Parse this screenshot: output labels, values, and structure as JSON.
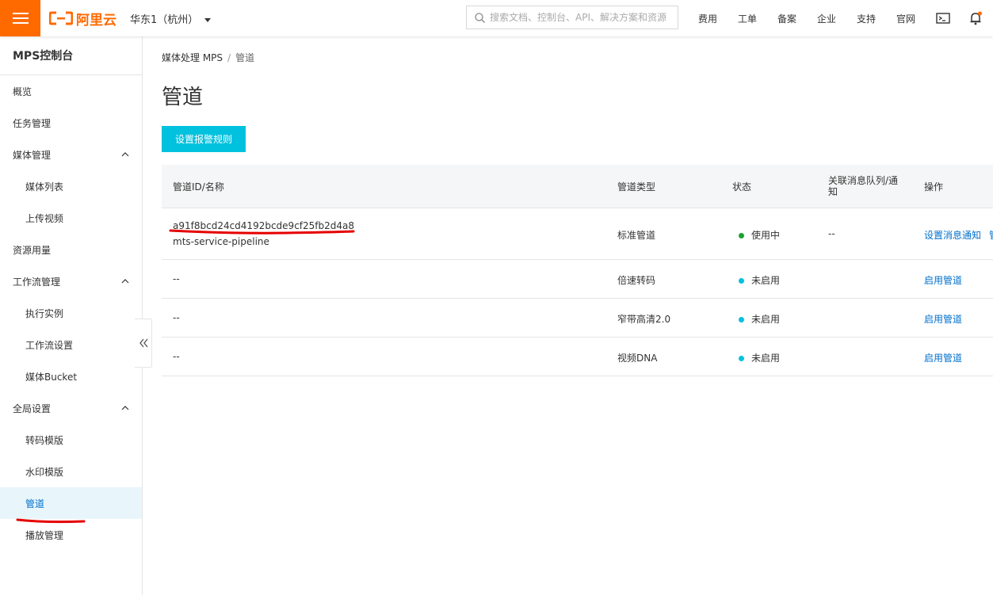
{
  "header": {
    "logo_text": "阿里云",
    "region": "华东1（杭州）",
    "search_placeholder": "搜索文档、控制台、API、解决方案和资源",
    "nav": [
      "费用",
      "工单",
      "备案",
      "企业",
      "支持",
      "官网"
    ]
  },
  "sidebar": {
    "title": "MPS控制台",
    "items": [
      {
        "label": "概览"
      },
      {
        "label": "任务管理"
      },
      {
        "label": "媒体管理"
      },
      {
        "label": "媒体列表"
      },
      {
        "label": "上传视频"
      },
      {
        "label": "资源用量"
      },
      {
        "label": "工作流管理"
      },
      {
        "label": "执行实例"
      },
      {
        "label": "工作流设置"
      },
      {
        "label": "媒体Bucket"
      },
      {
        "label": "全局设置"
      },
      {
        "label": "转码模版"
      },
      {
        "label": "水印模版"
      },
      {
        "label": "管道"
      },
      {
        "label": "播放管理"
      }
    ]
  },
  "breadcrumb": {
    "parent": "媒体处理 MPS",
    "separator": "/",
    "current": "管道"
  },
  "page": {
    "title": "管道",
    "alarm_button": "设置报警规则"
  },
  "table": {
    "headers": {
      "id_name": "管道ID/名称",
      "type": "管道类型",
      "status": "状态",
      "queue_line1": "关联消息队列/通",
      "queue_line2": "知",
      "actions": "操作"
    },
    "rows": [
      {
        "id": "a91f8bcd24cd4192bcde9cf25fb2d4a8",
        "name": "mts-service-pipeline",
        "type": "标准管道",
        "status": "使用中",
        "status_color": "#1aa32e",
        "queue": "--",
        "action": "设置消息通知",
        "action_extra": "管"
      },
      {
        "id": "--",
        "type": "倍速转码",
        "status": "未启用",
        "status_color": "#00c1de",
        "action": "启用管道"
      },
      {
        "id": "--",
        "type": "窄带高清2.0",
        "status": "未启用",
        "status_color": "#00c1de",
        "action": "启用管道"
      },
      {
        "id": "--",
        "type": "视频DNA",
        "status": "未启用",
        "status_color": "#00c1de",
        "action": "启用管道"
      }
    ]
  },
  "colors": {
    "brand": "#ff6a00",
    "primary_button": "#00c1de",
    "link": "#0070cc",
    "annotation": "#e60000"
  }
}
